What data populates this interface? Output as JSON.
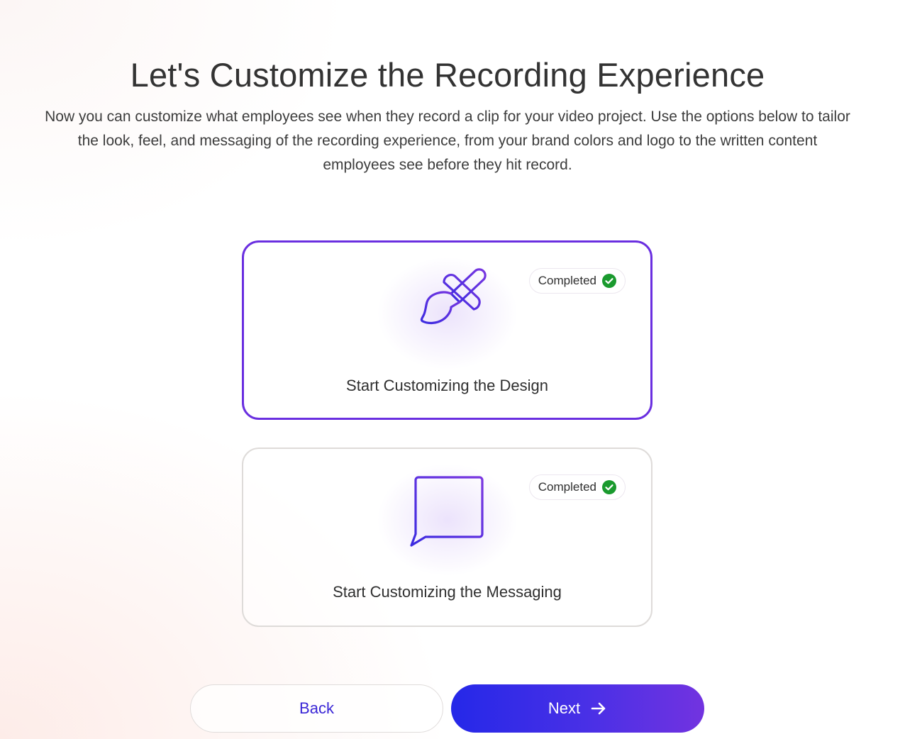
{
  "header": {
    "title": "Let's Customize the Recording Experience",
    "description": "Now you can customize what employees see when they record a clip for your video project. Use the options below to tailor the look, feel, and messaging of the recording experience, from your brand colors and logo to the written content employees see before they hit record."
  },
  "options": [
    {
      "label": "Start Customizing the Design",
      "icon": "paintbrush-icon",
      "status": "Completed",
      "status_icon": "check-circle-icon",
      "selected": true
    },
    {
      "label": "Start Customizing the Messaging",
      "icon": "chat-message-icon",
      "status": "Completed",
      "status_icon": "check-circle-icon",
      "selected": false
    }
  ],
  "footer": {
    "back_label": "Back",
    "next_label": "Next",
    "next_icon": "arrow-right-icon"
  },
  "colors": {
    "accent_purple": "#6a2fe0",
    "accent_blue": "#2528e8",
    "status_green": "#1a9a2e",
    "text_dark": "#333333"
  }
}
